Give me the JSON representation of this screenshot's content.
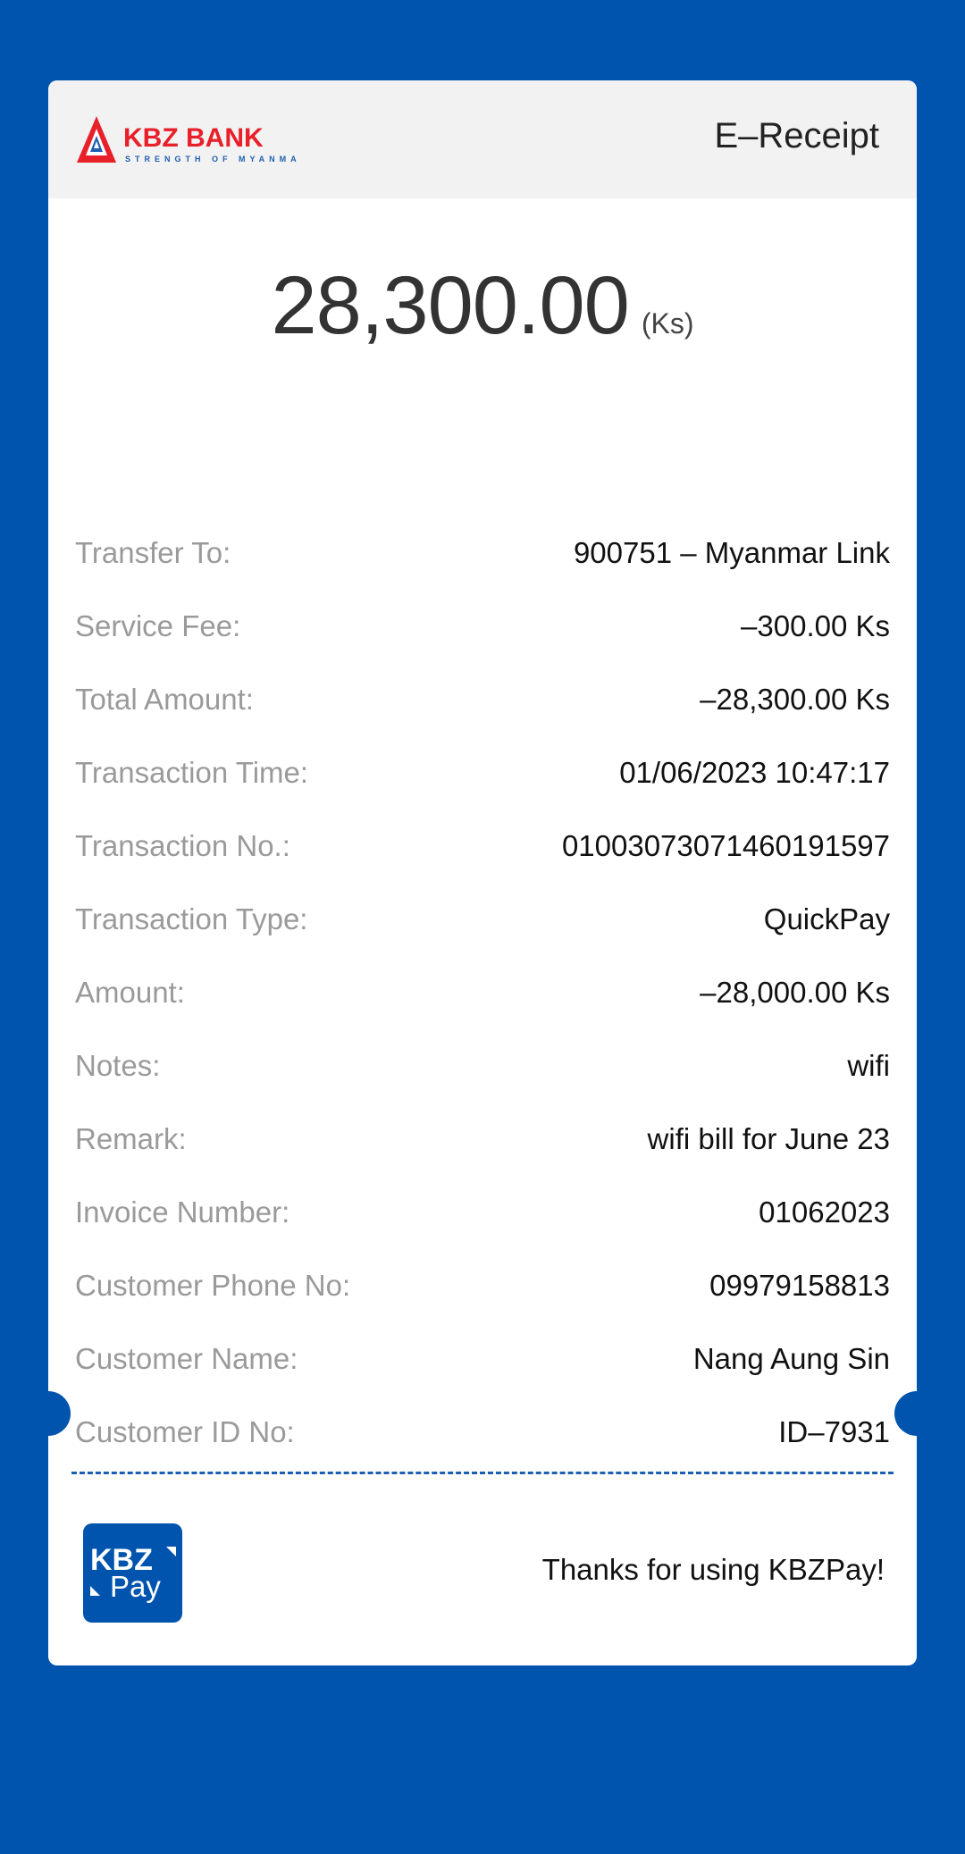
{
  "header": {
    "bank_name": "KBZ BANK",
    "bank_tagline": "STRENGTH OF MYANMAR",
    "title": "E–Receipt"
  },
  "amount": {
    "value": "28,300.00",
    "currency": "(Ks)"
  },
  "details": [
    {
      "label": "Transfer To:",
      "value": "900751 – Myanmar Link"
    },
    {
      "label": "Service Fee:",
      "value": "–300.00 Ks"
    },
    {
      "label": "Total Amount:",
      "value": "–28,300.00 Ks"
    },
    {
      "label": "Transaction Time:",
      "value": "01/06/2023 10:47:17"
    },
    {
      "label": "Transaction No.:",
      "value": "01003073071460191597"
    },
    {
      "label": "Transaction Type:",
      "value": "QuickPay"
    },
    {
      "label": "Amount:",
      "value": "–28,000.00 Ks"
    },
    {
      "label": "Notes:",
      "value": "wifi"
    },
    {
      "label": "Remark:",
      "value": "wifi bill for June 23"
    },
    {
      "label": "Invoice Number:",
      "value": "01062023"
    },
    {
      "label": "Customer Phone No:",
      "value": "09979158813"
    },
    {
      "label": "Customer Name:",
      "value": "Nang Aung Sin"
    },
    {
      "label": "Customer ID No:",
      "value": "ID–7931"
    }
  ],
  "footer": {
    "pay_logo_top": "KBZ",
    "pay_logo_bottom": "Pay",
    "thanks": "Thanks for using KBZPay!"
  },
  "colors": {
    "background": "#0054AE",
    "brand_red": "#E8202A",
    "brand_blue": "#1F5FB0"
  },
  "icons": {
    "bank_logo": "kbz-bank-logo-icon",
    "pay_logo": "kbzpay-logo-icon"
  }
}
